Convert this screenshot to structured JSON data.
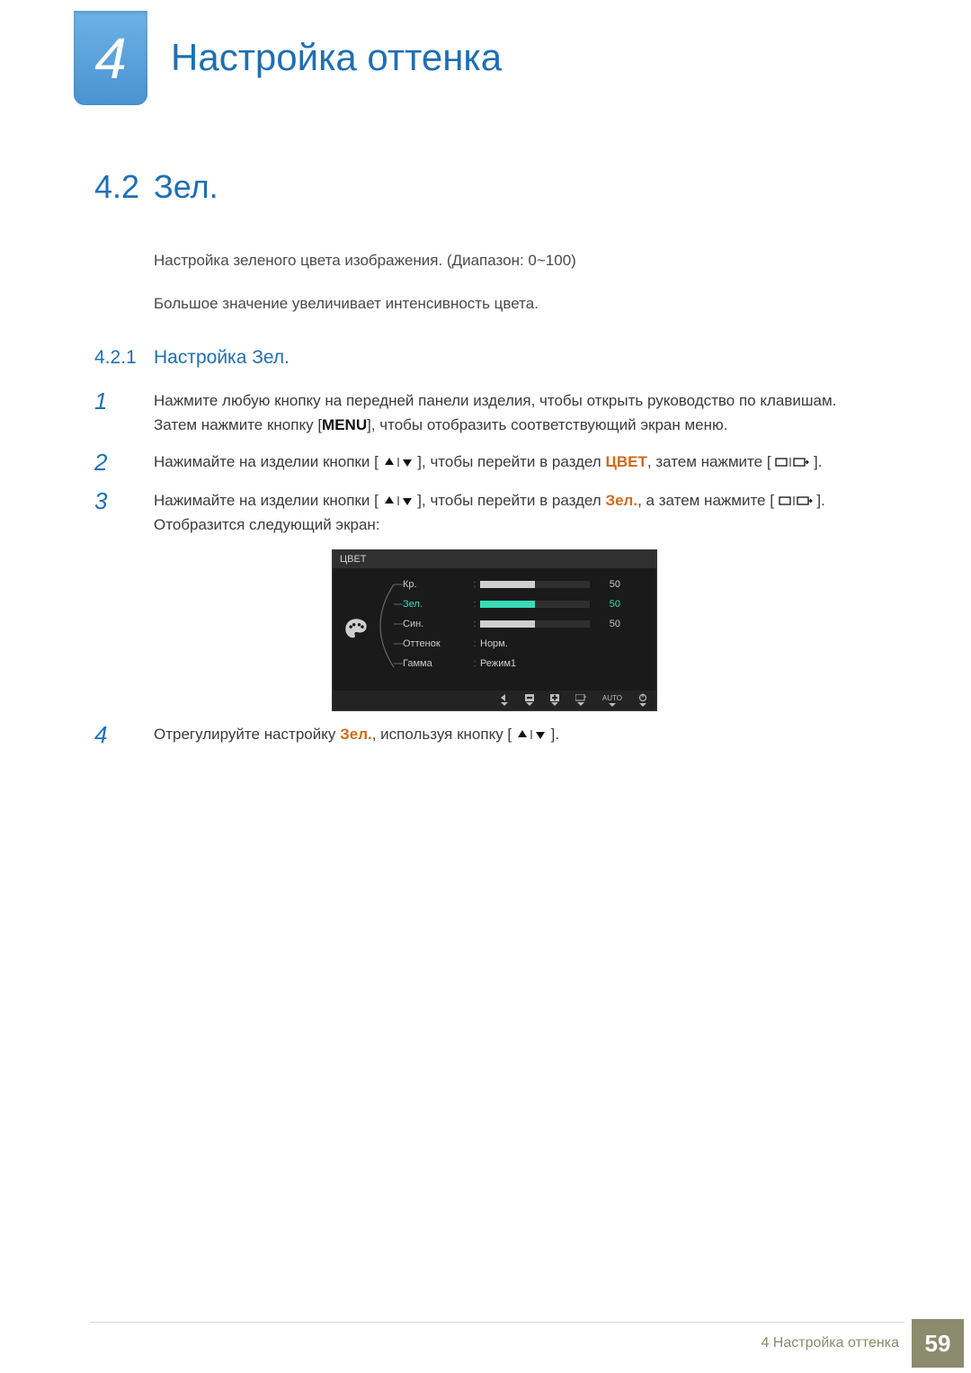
{
  "chapter": {
    "number": "4",
    "title": "Настройка оттенка"
  },
  "section": {
    "number": "4.2",
    "title": "Зел."
  },
  "intro": {
    "p1": "Настройка зеленого цвета изображения. (Диапазон: 0~100)",
    "p2": "Большое значение увеличивает интенсивность цвета."
  },
  "subsection": {
    "number": "4.2.1",
    "title": "Настройка Зел."
  },
  "steps": {
    "1": {
      "text_a": "Нажмите любую кнопку на передней панели изделия, чтобы открыть руководство по клавишам. Затем нажмите кнопку [",
      "menu": "MENU",
      "text_b": "], чтобы отобразить соответствующий экран меню."
    },
    "2": {
      "text_a": "Нажимайте на изделии кнопки [",
      "text_b": "], чтобы перейти в раздел ",
      "link": "ЦВЕТ",
      "text_c": ", затем нажмите [",
      "text_d": "]."
    },
    "3": {
      "text_a": "Нажимайте на изделии кнопки [",
      "text_b": "], чтобы перейти в раздел ",
      "link": "Зел.",
      "text_c": ", а затем нажмите [",
      "text_d": "]. Отобразится следующий экран:"
    },
    "4": {
      "text_a": "Отрегулируйте настройку ",
      "link": "Зел.",
      "text_b": ", используя кнопку [",
      "text_c": "]."
    }
  },
  "osd": {
    "title": "ЦВЕТ",
    "rows": {
      "red": {
        "label": "Кр.",
        "value": "50",
        "fill": 50
      },
      "green": {
        "label": "Зел.",
        "value": "50",
        "fill": 50
      },
      "blue": {
        "label": "Син.",
        "value": "50",
        "fill": 50
      },
      "tone": {
        "label": "Оттенок",
        "value": "Норм."
      },
      "gamma": {
        "label": "Гамма",
        "value": "Режим1"
      }
    },
    "footer": {
      "auto": "AUTO"
    }
  },
  "footer": {
    "text": "4 Настройка оттенка",
    "page": "59"
  }
}
